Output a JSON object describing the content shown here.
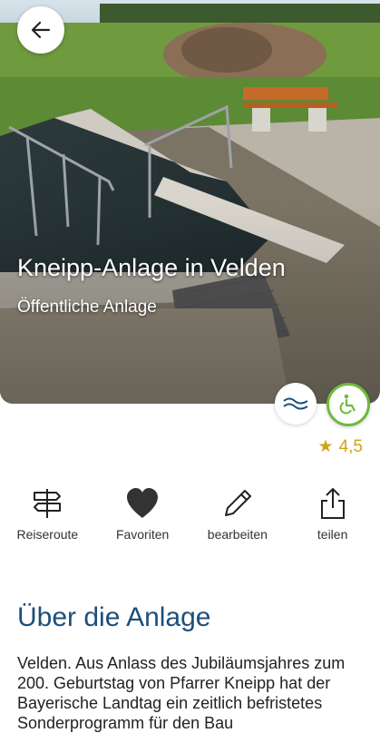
{
  "hero": {
    "title": "Kneipp-Anlage in Velden",
    "subtitle": "Öffentliche Anlage"
  },
  "badges": {
    "water_icon": "water-waves-icon",
    "accessible_icon": "wheelchair-icon",
    "accent_green": "#6dbb3a",
    "accent_blue": "#1d4f7a"
  },
  "rating": {
    "value": "4,5",
    "star_color": "#d4a216"
  },
  "actions": [
    {
      "label": "Reiseroute",
      "icon": "signpost-icon"
    },
    {
      "label": "Favoriten",
      "icon": "heart-icon"
    },
    {
      "label": "bearbeiten",
      "icon": "pencil-icon"
    },
    {
      "label": "teilen",
      "icon": "share-icon"
    }
  ],
  "about": {
    "title": "Über die Anlage",
    "text": "Velden. Aus Anlass des Jubiläumsjahres zum 200. Geburtstag von Pfarrer Kneipp hat der Bayerische Landtag ein zeitlich befristetes Sonderprogramm für den Bau"
  }
}
